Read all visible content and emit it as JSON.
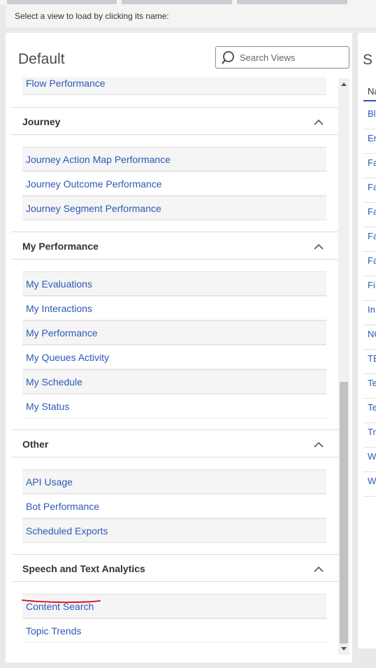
{
  "hint": "Select a view to load by clicking its name:",
  "panel": {
    "title": "Default",
    "search": {
      "placeholder": "Search Views",
      "value": ""
    }
  },
  "partial_item": "Flow Performance",
  "groups": [
    {
      "title": "Journey",
      "items": [
        "Journey Action Map Performance",
        "Journey Outcome Performance",
        "Journey Segment Performance"
      ]
    },
    {
      "title": "My Performance",
      "items": [
        "My Evaluations",
        "My Interactions",
        "My Performance",
        "My Queues Activity",
        "My Schedule",
        "My Status"
      ]
    },
    {
      "title": "Other",
      "items": [
        "API Usage",
        "Bot Performance",
        "Scheduled Exports"
      ]
    },
    {
      "title": "Speech and Text Analytics",
      "items": [
        "Content Search",
        "Topic Trends"
      ]
    }
  ],
  "right_panel": {
    "heading": "S",
    "column": "Na",
    "rows": [
      "Bl",
      "En",
      "Fa",
      "Fa",
      "Fa",
      "Fa",
      "Fa",
      "Fi",
      "In",
      "NC",
      "TE",
      "Te",
      "Te",
      "Tr",
      "W",
      "W"
    ]
  },
  "colors": {
    "link": "#2e58b8",
    "annotation": "#e0001a",
    "scroll_thumb": "#c1c1c1"
  }
}
